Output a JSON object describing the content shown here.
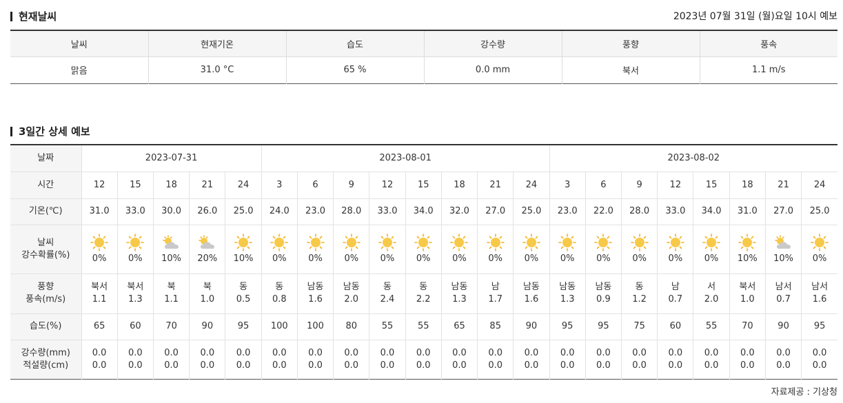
{
  "current": {
    "title": "현재날씨",
    "observed_at": "2023년 07월 31일 (월)요일 10시 예보",
    "headers": [
      "날씨",
      "현재기온",
      "습도",
      "강수량",
      "풍향",
      "풍속"
    ],
    "values": [
      "맑음",
      "31.0 °C",
      "65 %",
      "0.0 mm",
      "북서",
      "1.1 m/s"
    ]
  },
  "forecast": {
    "title": "3일간 상세 예보",
    "row_labels": {
      "date": "날짜",
      "time": "시간",
      "temp": "기온(℃)",
      "weather_line1": "날씨",
      "weather_line2": "강수확률(%)",
      "wind_line1": "풍향",
      "wind_line2": "풍속(m/s)",
      "humidity": "습도(%)",
      "rain_line1": "강수량(mm)",
      "rain_line2": "적설량(cm)"
    },
    "dates": [
      {
        "label": "2023-07-31",
        "span": 5
      },
      {
        "label": "2023-08-01",
        "span": 8
      },
      {
        "label": "2023-08-02",
        "span": 8
      }
    ],
    "slots": [
      {
        "time": "12",
        "temp": "31.0",
        "icon": "sun-icon",
        "pop": "0%",
        "wind_dir": "북서",
        "wind_speed": "1.1",
        "humidity": "65",
        "rain": "0.0",
        "snow": "0.0"
      },
      {
        "time": "15",
        "temp": "33.0",
        "icon": "sun-icon",
        "pop": "0%",
        "wind_dir": "북서",
        "wind_speed": "1.3",
        "humidity": "60",
        "rain": "0.0",
        "snow": "0.0"
      },
      {
        "time": "18",
        "temp": "30.0",
        "icon": "partly-cloudy-icon",
        "pop": "10%",
        "wind_dir": "북",
        "wind_speed": "1.1",
        "humidity": "70",
        "rain": "0.0",
        "snow": "0.0"
      },
      {
        "time": "21",
        "temp": "26.0",
        "icon": "partly-cloudy-icon",
        "pop": "20%",
        "wind_dir": "북",
        "wind_speed": "1.0",
        "humidity": "90",
        "rain": "0.0",
        "snow": "0.0"
      },
      {
        "time": "24",
        "temp": "25.0",
        "icon": "sun-icon",
        "pop": "10%",
        "wind_dir": "동",
        "wind_speed": "0.5",
        "humidity": "95",
        "rain": "0.0",
        "snow": "0.0"
      },
      {
        "time": "3",
        "temp": "24.0",
        "icon": "sun-icon",
        "pop": "0%",
        "wind_dir": "동",
        "wind_speed": "0.8",
        "humidity": "100",
        "rain": "0.0",
        "snow": "0.0"
      },
      {
        "time": "6",
        "temp": "23.0",
        "icon": "sun-icon",
        "pop": "0%",
        "wind_dir": "남동",
        "wind_speed": "1.6",
        "humidity": "100",
        "rain": "0.0",
        "snow": "0.0"
      },
      {
        "time": "9",
        "temp": "28.0",
        "icon": "sun-icon",
        "pop": "0%",
        "wind_dir": "남동",
        "wind_speed": "2.0",
        "humidity": "80",
        "rain": "0.0",
        "snow": "0.0"
      },
      {
        "time": "12",
        "temp": "33.0",
        "icon": "sun-icon",
        "pop": "0%",
        "wind_dir": "동",
        "wind_speed": "2.4",
        "humidity": "55",
        "rain": "0.0",
        "snow": "0.0"
      },
      {
        "time": "15",
        "temp": "34.0",
        "icon": "sun-icon",
        "pop": "0%",
        "wind_dir": "동",
        "wind_speed": "2.2",
        "humidity": "55",
        "rain": "0.0",
        "snow": "0.0"
      },
      {
        "time": "18",
        "temp": "32.0",
        "icon": "sun-icon",
        "pop": "0%",
        "wind_dir": "남동",
        "wind_speed": "1.3",
        "humidity": "65",
        "rain": "0.0",
        "snow": "0.0"
      },
      {
        "time": "21",
        "temp": "27.0",
        "icon": "sun-icon",
        "pop": "0%",
        "wind_dir": "남",
        "wind_speed": "1.7",
        "humidity": "85",
        "rain": "0.0",
        "snow": "0.0"
      },
      {
        "time": "24",
        "temp": "25.0",
        "icon": "sun-icon",
        "pop": "0%",
        "wind_dir": "남동",
        "wind_speed": "1.6",
        "humidity": "90",
        "rain": "0.0",
        "snow": "0.0"
      },
      {
        "time": "3",
        "temp": "23.0",
        "icon": "sun-icon",
        "pop": "0%",
        "wind_dir": "남동",
        "wind_speed": "1.3",
        "humidity": "95",
        "rain": "0.0",
        "snow": "0.0"
      },
      {
        "time": "6",
        "temp": "22.0",
        "icon": "sun-icon",
        "pop": "0%",
        "wind_dir": "남동",
        "wind_speed": "0.9",
        "humidity": "95",
        "rain": "0.0",
        "snow": "0.0"
      },
      {
        "time": "9",
        "temp": "28.0",
        "icon": "sun-icon",
        "pop": "0%",
        "wind_dir": "동",
        "wind_speed": "1.2",
        "humidity": "75",
        "rain": "0.0",
        "snow": "0.0"
      },
      {
        "time": "12",
        "temp": "33.0",
        "icon": "sun-icon",
        "pop": "0%",
        "wind_dir": "남",
        "wind_speed": "0.7",
        "humidity": "60",
        "rain": "0.0",
        "snow": "0.0"
      },
      {
        "time": "15",
        "temp": "34.0",
        "icon": "sun-icon",
        "pop": "0%",
        "wind_dir": "서",
        "wind_speed": "2.0",
        "humidity": "55",
        "rain": "0.0",
        "snow": "0.0"
      },
      {
        "time": "18",
        "temp": "31.0",
        "icon": "sun-icon",
        "pop": "10%",
        "wind_dir": "북서",
        "wind_speed": "1.0",
        "humidity": "70",
        "rain": "0.0",
        "snow": "0.0"
      },
      {
        "time": "21",
        "temp": "27.0",
        "icon": "partly-cloudy-icon",
        "pop": "10%",
        "wind_dir": "남서",
        "wind_speed": "0.7",
        "humidity": "90",
        "rain": "0.0",
        "snow": "0.0"
      },
      {
        "time": "24",
        "temp": "25.0",
        "icon": "sun-icon",
        "pop": "0%",
        "wind_dir": "남서",
        "wind_speed": "1.6",
        "humidity": "95",
        "rain": "0.0",
        "snow": "0.0"
      }
    ]
  },
  "source": "자료제공 : 기상청",
  "colors": {
    "sun": "#f7c948",
    "sun_edge": "#f2b01e",
    "cloud": "#c9c9c9",
    "header_bg": "#f5f5f5"
  }
}
